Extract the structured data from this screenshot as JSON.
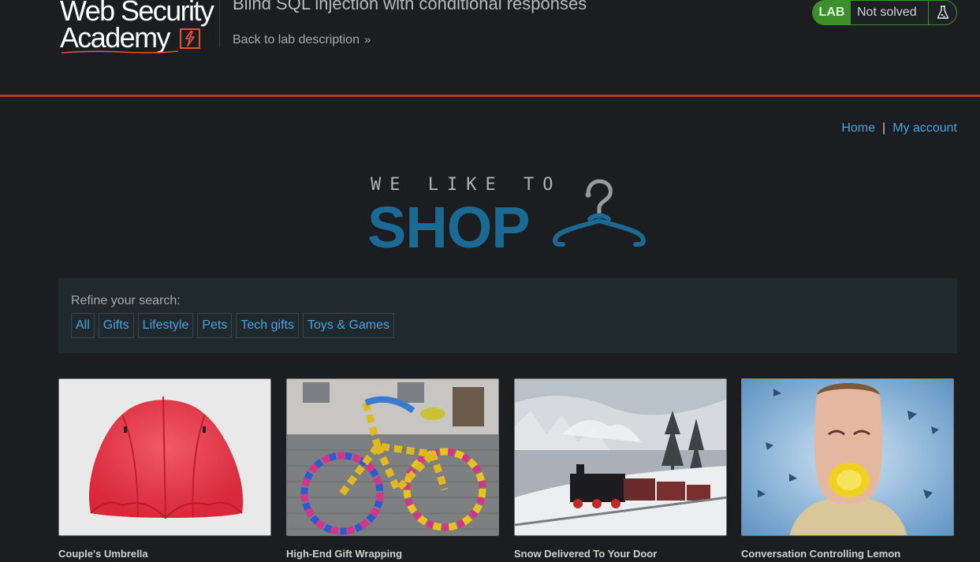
{
  "lab_header": {
    "logo_line1": "Web Security",
    "logo_line2": "Academy",
    "title": "Blind SQL injection with conditional responses",
    "back_link": "Back to lab description",
    "back_chevron": "»",
    "status_badge": "LAB",
    "status_text": "Not solved",
    "accent_color": "#a93d18",
    "status_color": "#3e8f2c"
  },
  "nav": {
    "home": "Home",
    "separator": "|",
    "my_account": "My account",
    "link_color": "#4aa3df"
  },
  "shop_logo": {
    "tagline": "WE LIKE TO",
    "word": "SHOP",
    "icon": "hanger-icon",
    "brand_color": "#1b6a93"
  },
  "filter": {
    "label": "Refine your search:",
    "categories": [
      "All",
      "Gifts",
      "Lifestyle",
      "Pets",
      "Tech gifts",
      "Toys & Games"
    ]
  },
  "products": [
    {
      "name": "Couple's Umbrella",
      "image": "red-umbrella-photo"
    },
    {
      "name": "High-End Gift Wrapping",
      "image": "knitted-bicycle-photo"
    },
    {
      "name": "Snow Delivered To Your Door",
      "image": "steam-train-snow-photo"
    },
    {
      "name": "Conversation Controlling Lemon",
      "image": "man-with-lemon-photo"
    }
  ]
}
